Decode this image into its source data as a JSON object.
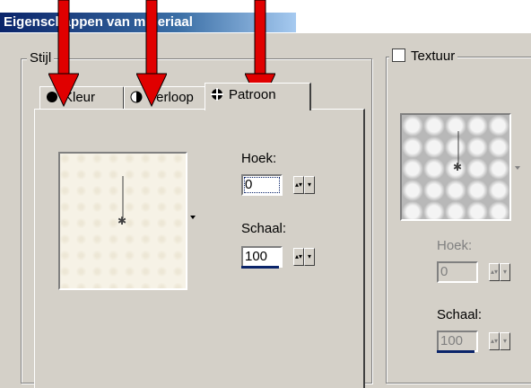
{
  "window": {
    "title": "Eigenschappen van materiaal"
  },
  "style_group": {
    "label": "Stijl"
  },
  "tabs": [
    {
      "label": "Kleur",
      "icon": "circle-filled-icon"
    },
    {
      "label": "Verloop",
      "icon": "half-circle-icon"
    },
    {
      "label": "Patroon",
      "icon": "pattern-icon",
      "active": true
    }
  ],
  "pattern_panel": {
    "angle_label": "Hoek:",
    "angle_value": "0",
    "scale_label": "Schaal:",
    "scale_value": "100"
  },
  "texture_group": {
    "checkbox_label": "Textuur",
    "checked": false,
    "angle_label": "Hoek:",
    "angle_value": "0",
    "scale_label": "Schaal:",
    "scale_value": "100"
  },
  "colors": {
    "annotation_arrow": "#e00000",
    "title_bar": "#0a246a",
    "dialog_bg": "#d4d0c8"
  }
}
